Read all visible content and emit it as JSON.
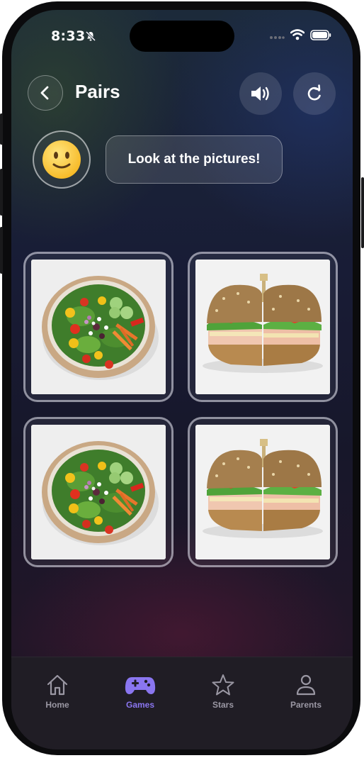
{
  "status_bar": {
    "time": "8:33"
  },
  "header": {
    "title": "Pairs"
  },
  "speech": {
    "text": "Look at the pictures!"
  },
  "cards": [
    {
      "picture": "salad"
    },
    {
      "picture": "sandwich"
    },
    {
      "picture": "salad"
    },
    {
      "picture": "sandwich"
    }
  ],
  "tabs": [
    {
      "label": "Home",
      "icon": "home-icon",
      "active": false
    },
    {
      "label": "Games",
      "icon": "gamepad-icon",
      "active": true
    },
    {
      "label": "Stars",
      "icon": "star-icon",
      "active": false
    },
    {
      "label": "Parents",
      "icon": "person-icon",
      "active": false
    }
  ],
  "colors": {
    "accent": "#8a76f0"
  }
}
